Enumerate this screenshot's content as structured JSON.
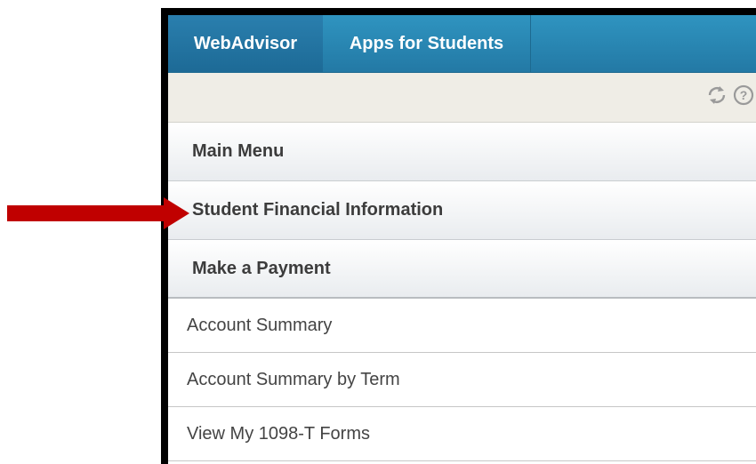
{
  "tabs": [
    {
      "label": "WebAdvisor"
    },
    {
      "label": "Apps for Students"
    }
  ],
  "toolbar": {
    "icons": [
      "refresh-icon",
      "help-icon"
    ]
  },
  "menu": {
    "main_menu": "Main Menu",
    "student_financial": "Student Financial Information",
    "make_payment": "Make a Payment",
    "links": [
      "Account Summary",
      "Account Summary by Term",
      "View My 1098-T Forms"
    ]
  },
  "colors": {
    "tab_bar": "#2a88b6",
    "arrow": "#c00000",
    "toolbar_bg": "#efede6"
  }
}
